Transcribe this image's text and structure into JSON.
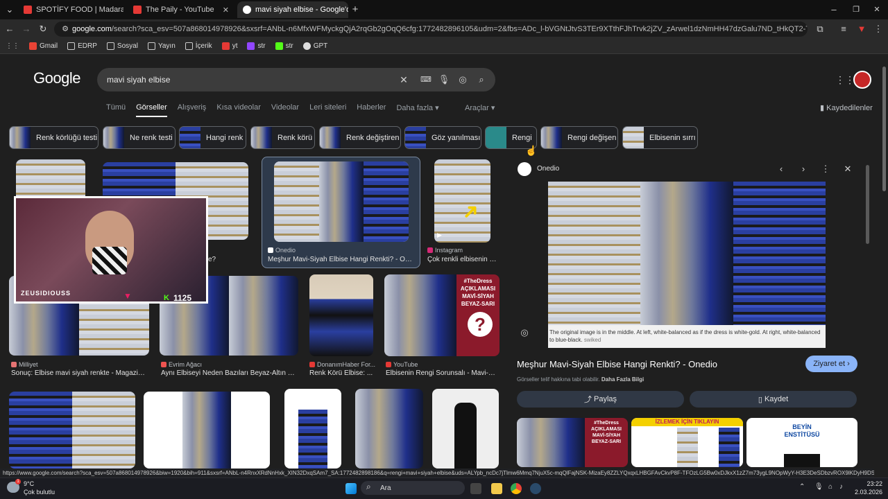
{
  "tabs": [
    {
      "title": "SPOTİFY FOOD | Madara Olduk",
      "color": "#e53935"
    },
    {
      "title": "The Paily - YouTube",
      "color": "#e53935"
    },
    {
      "title": "mavi siyah elbise - Google'da A",
      "color": "#ffffff"
    }
  ],
  "url": {
    "host": "google.com",
    "rest": "/search?sca_esv=507a868014978926&sxsrf=ANbL-n6MfxWFMyckgQjA2rqGb2gOqQ6cfg:1772482896105&udm=2&fbs=ADc_l-bVGNtJtvS3TEr9XTthFJhTrvk2jZV_zArwel1dzNmHH47dzGalu7ND_tHkQT2-Tg9P3FNMLYc1_O8F0t0qDYU1Y8M..."
  },
  "bookmarks": [
    "Gmail",
    "EDRP",
    "Sosyal",
    "Yayın",
    "İçerik",
    "yt",
    "str",
    "str",
    "GPT"
  ],
  "google": {
    "logo": "Google",
    "query": "mavi siyah elbise",
    "nav": [
      "Tümü",
      "Görseller",
      "Alışveriş",
      "Kısa videolar",
      "Videolar",
      "Leri siteleri",
      "Haberler",
      "Daha fazla ▾"
    ],
    "tools": "Araçlar ▾",
    "saved": "Kaydedilenler"
  },
  "chips": [
    "Renk körlüğü testi",
    "Ne renk testi",
    "Hangi renk",
    "Renk körü",
    "Renk değiştiren",
    "Göz yanılması",
    "Rengi",
    "Rengi değişen",
    "Elbisenin sırrı"
  ],
  "results": {
    "row1": [
      {
        "source": "Onedio",
        "caption": "Meşhur Mavi-Siyah Elbise Hangi Renkti? - One..."
      },
      {
        "source": "Instagram",
        "caption": "Çok renkli elbisenin s..."
      }
    ],
    "row1_partial": "e?",
    "row2": [
      {
        "source": "Milliyet",
        "caption": "Sonuç: Elbise mavi siyah renkte - Magazin ..."
      },
      {
        "source": "Evrim Ağacı",
        "caption": "Aynı Elbiseyi Neden Bazıları Beyaz-Altın R..."
      },
      {
        "source": "DonanımHaber For...",
        "caption": "Renk Körü Elbise: ..."
      },
      {
        "source": "YouTube",
        "caption": "Elbisenin Rengi Sorunsalı - Mavi-Si..."
      }
    ],
    "dress_overlay": [
      "#TheDress",
      "AÇIKLAMASI",
      "MAVİ-SİYAH",
      "BEYAZ-SARI"
    ]
  },
  "panel": {
    "source": "Onedio",
    "image_caption": "The original image is in the middle. At left, white-balanced as if the dress is white-gold. At right, white-balanced to blue-black.",
    "credit": "swiked",
    "title": "Meşhur Mavi-Siyah Elbise Hangi Renkti? - Onedio",
    "visit": "Ziyaret et",
    "copyright": "Görseller telif hakkına tabi olabilir.",
    "more_info": "Daha Fazla Bilgi",
    "share": "Paylaş",
    "save": "Kaydet",
    "thumb_label": "İZLEMEK İÇİN TIKLAYIN",
    "beyin": "BEYİN ENSTİTÜSÜ"
  },
  "stream": {
    "name": "ZEUSIDIOUSS",
    "count": "1125"
  },
  "status_url": "https://www.google.com/search?sca_esv=507a868014978926&biw=1920&bih=911&sxsrf=ANbL-n4RnxXRdNnHxk_XIN32DxqSAm7_SA:1772482898186&q=rengi+mavi+siyah+elbise&uds=ALYpb_ncDc7jTlmw6Mmq7NjuX5c-mqQlFajNSK-MizaEy8ZZLYQxqxLHBGFAvCkvP8F-TFOzLG5Bw0xDJkxX1zZ7m73ygL9NOpWyY-H3E3DeSDbzvROX9lKDyH9DSOMxvi...",
  "taskbar": {
    "temp": "9°C",
    "weather": "Çok bulutlu",
    "search": "Ara",
    "time": "23:22",
    "date": "2.03.2026"
  }
}
